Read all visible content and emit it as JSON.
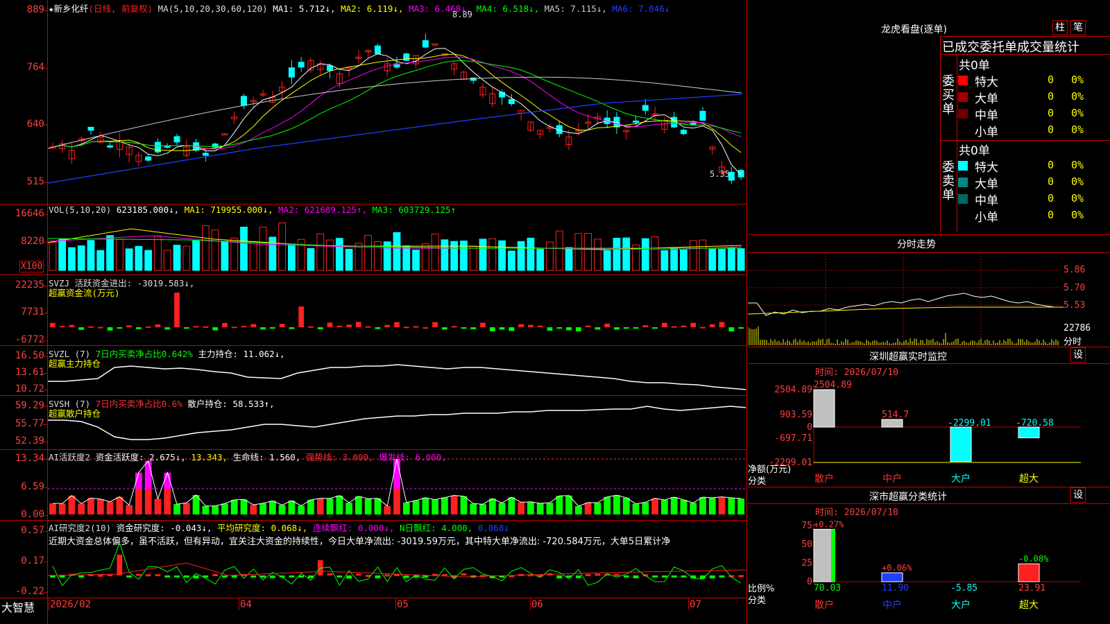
{
  "stock_title": "★新乡化纤",
  "stock_mode": "(日线, 前复权)",
  "ma_legend": [
    {
      "label": "MA(5,10,20,30,60,120)",
      "color": "#dddddd"
    },
    {
      "label": "MA1: 5.712↓,",
      "color": "#ffffff"
    },
    {
      "label": "MA2: 6.119↓,",
      "color": "#ffff00"
    },
    {
      "label": "MA3: 6.468↓,",
      "color": "#ff00ff"
    },
    {
      "label": "MA4: 6.518↓,",
      "color": "#00ff00"
    },
    {
      "label": "MA5: 7.115↓,",
      "color": "#cccccc"
    },
    {
      "label": "MA6: 7.046↓",
      "color": "#2040ff"
    }
  ],
  "price_axis": [
    "889",
    "764",
    "640",
    "515"
  ],
  "price_high_label": "8.89",
  "price_low_label": "5.35",
  "vol_legend": [
    {
      "label": "VOL(5,10,20)",
      "color": "#dddddd"
    },
    {
      "label": "623185.000↓,",
      "color": "#ffffff"
    },
    {
      "label": "MA1: 719955.000↓,",
      "color": "#ffff00"
    },
    {
      "label": "MA2: 621689.125↑,",
      "color": "#ff00ff"
    },
    {
      "label": "MA3: 603729.125↑",
      "color": "#00ff00"
    }
  ],
  "vol_axis": [
    "16646",
    "8220"
  ],
  "vol_unit": "X100",
  "svzj_legend": [
    {
      "label": "SVZJ  活跃资金进出: -3019.583↓,",
      "color": "#dddddd"
    }
  ],
  "svzj_subtitle": "超赢资金流(万元)",
  "svzj_axis": [
    "22235",
    "7731",
    "-6772"
  ],
  "svzl_legend": [
    {
      "label": "SVZL (7)",
      "color": "#dddddd"
    },
    {
      "label": "7日内买卖净占比0.642%",
      "color": "#00ff00"
    },
    {
      "label": "主力持仓: 11.062↓,",
      "color": "#ffffff"
    }
  ],
  "svzl_subtitle": "超赢主力持仓",
  "svzl_axis": [
    "16.50",
    "13.61",
    "10.72"
  ],
  "svsh_legend": [
    {
      "label": "SVSH (7)",
      "color": "#dddddd"
    },
    {
      "label": "7日内买卖净占比0.6%",
      "color": "#ff3030"
    },
    {
      "label": "散户持仓: 58.533↑,",
      "color": "#ffffff"
    }
  ],
  "svsh_subtitle": "超赢散户持仓",
  "svsh_axis": [
    "59.29",
    "55.77",
    "52.39"
  ],
  "ai1_legend": [
    {
      "label": "AI活跃度2",
      "color": "#dddddd"
    },
    {
      "label": "资金活跃度: 2.675↓,",
      "color": "#ffffff"
    },
    {
      "label": "13.343,",
      "color": "#ffff00"
    },
    {
      "label": "生命线: 1.560,",
      "color": "#ffffff"
    },
    {
      "label": "强势线: 3.000,",
      "color": "#ff3030"
    },
    {
      "label": "爆发线: 6.000,",
      "color": "#ff00ff"
    }
  ],
  "ai1_axis": [
    "13.34",
    "6.59",
    "0.00"
  ],
  "ai2_legend": [
    {
      "label": "AI研究度2(10)",
      "color": "#dddddd"
    },
    {
      "label": "资金研究度: -0.043↓,",
      "color": "#ffffff"
    },
    {
      "label": "平均研究度: 0.068↓,",
      "color": "#ffff00"
    },
    {
      "label": "连续飘红: 0.000↓,",
      "color": "#ff00ff"
    },
    {
      "label": "N日飘红: 4.000,",
      "color": "#00ff00"
    },
    {
      "label": "0.068↓",
      "color": "#2040ff"
    }
  ],
  "ai2_comment": "近期大资金总体偏多，虽不活跃，但有异动，宜关注大资金的持续性，今日大单净流出: -3019.59万元，其中特大单净流出: -720.584万元，大单5日累计净",
  "ai2_axis": [
    "0.57",
    "0.17",
    "-0.22"
  ],
  "date_axis": [
    "2026/02",
    "04",
    "05",
    "06",
    "07"
  ],
  "brand": "大智慧",
  "right": {
    "lhb_title": "龙虎看盘(逐单)",
    "btn_col": "柱",
    "btn_pen": "笔",
    "stat_title": "已成交委托单成交量统计",
    "buy_label": "委买单",
    "sell_label": "委卖单",
    "buy_total": "共0单",
    "sell_total": "共0单",
    "buy_rows": [
      {
        "name": "特大",
        "val": "0",
        "pct": "0%",
        "color": "#ff0000"
      },
      {
        "name": "大单",
        "val": "0",
        "pct": "0%",
        "color": "#a00000"
      },
      {
        "name": "中单",
        "val": "0",
        "pct": "0%",
        "color": "#700000"
      },
      {
        "name": "小单",
        "val": "0",
        "pct": "0%",
        "color": ""
      }
    ],
    "sell_rows": [
      {
        "name": "特大",
        "val": "0",
        "pct": "0%",
        "color": "#00ffff"
      },
      {
        "name": "大单",
        "val": "0",
        "pct": "0%",
        "color": "#008888"
      },
      {
        "name": "中单",
        "val": "0",
        "pct": "0%",
        "color": "#006666"
      },
      {
        "name": "小单",
        "val": "0",
        "pct": "0%",
        "color": ""
      }
    ],
    "intraday_title": "分时走势",
    "intraday_axis": [
      "5.86",
      "5.70",
      "5.53",
      "22786",
      "分时"
    ],
    "monitor_title": "深圳超赢实时监控",
    "monitor_set": "设",
    "monitor_date": "时间: 2026/07/10",
    "monitor_axis": [
      "2504.89",
      "903.59",
      "0",
      "-697.71",
      "-2299.01"
    ],
    "monitor_unit": "净额(万元)",
    "monitor_cat": "分类",
    "monitor_bars": [
      {
        "label": "散户",
        "value": 2504.89,
        "text": "2504.89"
      },
      {
        "label": "中户",
        "value": 514.7,
        "text": "514.7"
      },
      {
        "label": "大户",
        "value": -2299.01,
        "text": "-2299.01"
      },
      {
        "label": "超大",
        "value": -720.58,
        "text": "-720.58"
      }
    ],
    "class_title": "深市超赢分类统计",
    "class_set": "设",
    "class_date": "时间: 2026/07/10",
    "class_axis": [
      "75",
      "50",
      "25",
      "0"
    ],
    "class_unit": "比例%",
    "class_cat": "分类",
    "class_bars": [
      {
        "label": "散户",
        "value": 70.03,
        "text": "70.03",
        "pct": "+0.27%"
      },
      {
        "label": "中户",
        "value": 11.9,
        "text": "11.90",
        "pct": "+0.06%"
      },
      {
        "label": "大户",
        "value": -5.85,
        "text": "-5.85",
        "pct": ""
      },
      {
        "label": "超大",
        "value": 23.91,
        "text": "23.91",
        "pct": "-0.08%"
      }
    ]
  },
  "colors": {
    "up": "#ff2020",
    "down": "#00ffff",
    "grid": "#cc0000",
    "axis_text": "#ff4040"
  }
}
